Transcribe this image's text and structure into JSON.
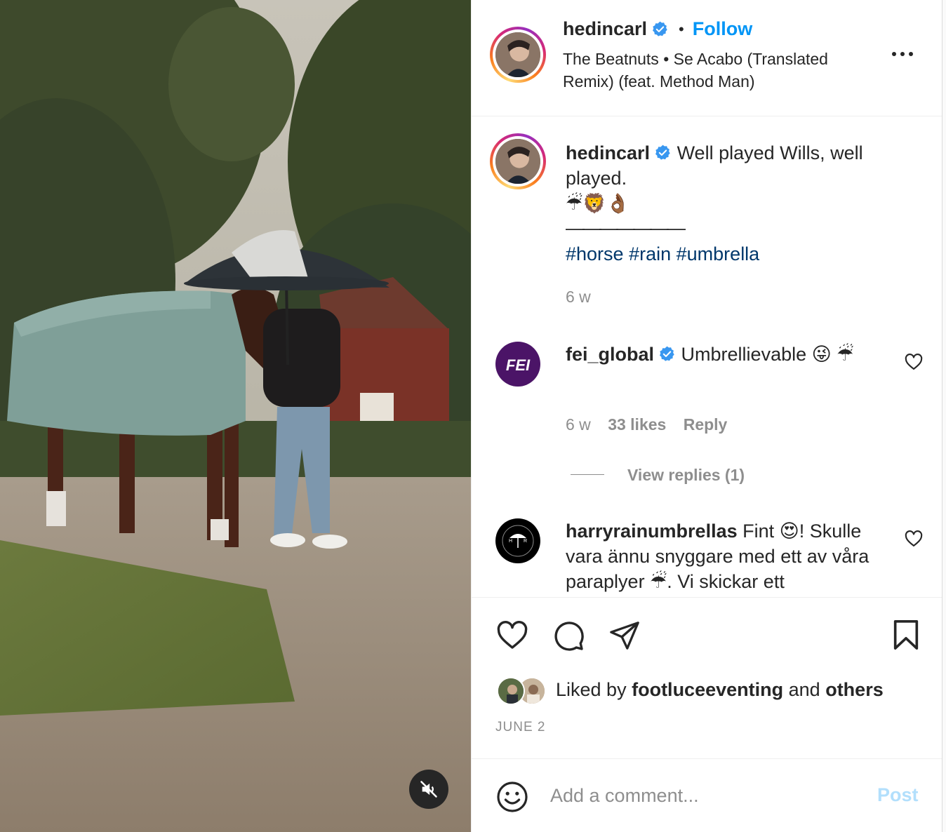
{
  "header": {
    "username": "hedincarl",
    "separator": "•",
    "follow_label": "Follow",
    "audio_text": "The Beatnuts • Se Acabo (Translated Remix) (feat. Method Man)"
  },
  "caption": {
    "username": "hedincarl",
    "text": "Well played Wills, well played.",
    "emojis": "☔🦁👌🏾",
    "divider": "———————",
    "hashtags": [
      "#horse",
      "#rain",
      "#umbrella"
    ],
    "time": "6 w"
  },
  "comments": [
    {
      "username": "fei_global",
      "text": "Umbrellievable 😜 ☔",
      "time": "6 w",
      "likes": "33 likes",
      "reply_label": "Reply",
      "view_replies": "View replies (1)"
    },
    {
      "username": "harryrainumbrellas",
      "text": "Fint 😍! Skulle vara ännu snyggare med ett av våra paraplyer ☔. Vi skickar ett"
    }
  ],
  "likes": {
    "prefix": "Liked by",
    "user": "footluceeventing",
    "and": "and",
    "others": "others"
  },
  "date": "JUNE 2",
  "add_comment": {
    "placeholder": "Add a comment...",
    "post_label": "Post"
  },
  "icons": {
    "verified": "verified-badge-icon",
    "more": "more-options-icon",
    "like": "heart-icon",
    "comment": "comment-icon",
    "share": "share-icon",
    "save": "bookmark-icon",
    "emoji": "emoji-icon",
    "mute": "muted-speaker-icon"
  },
  "colors": {
    "accent": "#0095f6",
    "hashtag": "#00376b",
    "secondary_text": "#8e8e8e",
    "post_disabled": "#b2dffc",
    "fei_brand": "#4b1467"
  }
}
